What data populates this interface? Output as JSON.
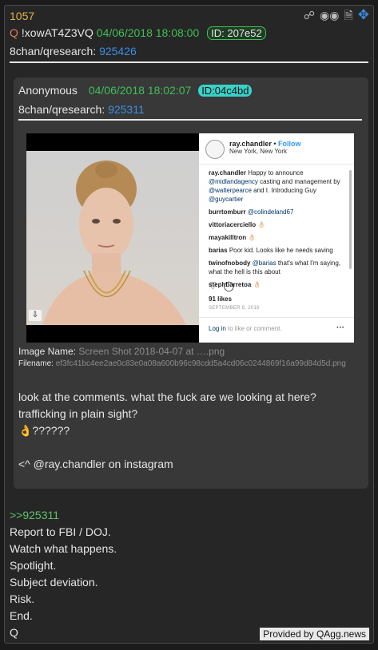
{
  "post": {
    "number": "1057",
    "q_icon": "Q",
    "tripcode": "!xowAT4Z3VQ",
    "date": "04/06/2018 18:08:00",
    "id": "ID: 207e52",
    "board": "8chan/qresearch:",
    "thread": "925426",
    "tools": [
      "share-icon",
      "vr-icon",
      "document-icon",
      "move-icon"
    ],
    "lines_greentext": ">>925311",
    "lines": [
      "Report to FBI / DOJ.",
      "Watch what happens.",
      "Spotlight.",
      "Subject deviation.",
      "Risk.",
      "End.",
      "Q"
    ]
  },
  "quote": {
    "author": "Anonymous",
    "date": "04/06/2018 18:02:07",
    "id": "ID:04c4bd",
    "board": "8chan/qresearch:",
    "thread": "925311",
    "image_name_label": "Image Name:",
    "image_name": "Screen Shot 2018-04-07 at ….png",
    "filename_label": "Filename:",
    "filename": "ef3fc41bc4ee2ae0c83e0a08a600b96c98cdd5a4cd06c0244869f16a99d84d5d.png",
    "text": [
      "look at the comments. what the fuck are we looking at here?",
      "trafficking in plain sight?",
      "👌??????",
      "",
      "<^ @ray.chandler on instagram"
    ]
  },
  "instagram": {
    "user": "ray.chandler",
    "follow": "Follow",
    "location": "New York, New York",
    "caption_user": "ray.chandler",
    "caption_text": "Happy to announce",
    "caption_m1": "@midlandagency",
    "caption_mid": "casting and management by",
    "caption_m2": "@walterpearce",
    "caption_end": "and I. Introducing Guy",
    "caption_m3": "@guycartier",
    "c1_user": "burrtomburr",
    "c1_text": "@colindeland67",
    "c2_user": "vittoriacerciello",
    "c2_text": "👌🏻",
    "c3_user": "mayakilltron",
    "c3_text": "👌🏻",
    "c4_user": "barias",
    "c4_text": "Poor kid. Looks like he needs saving",
    "c5_user": "twinofnobody",
    "c5_m": "@barias",
    "c5_text": "that's what I'm saying, what the hell is this about",
    "c6_user": "stephbarretoa",
    "c6_text": "👌🏻",
    "likes": "91 likes",
    "post_date": "SEPTEMBER 8, 2016",
    "login": "Log in",
    "login_rest": "to like or comment.",
    "more": "···"
  },
  "credit": "Provided by QAgg.news",
  "colors": {
    "date": "#3fbf5a",
    "link": "#3a8ee6",
    "post_number": "#e0b14a",
    "id_badge_quote": "#3ad1c7"
  }
}
